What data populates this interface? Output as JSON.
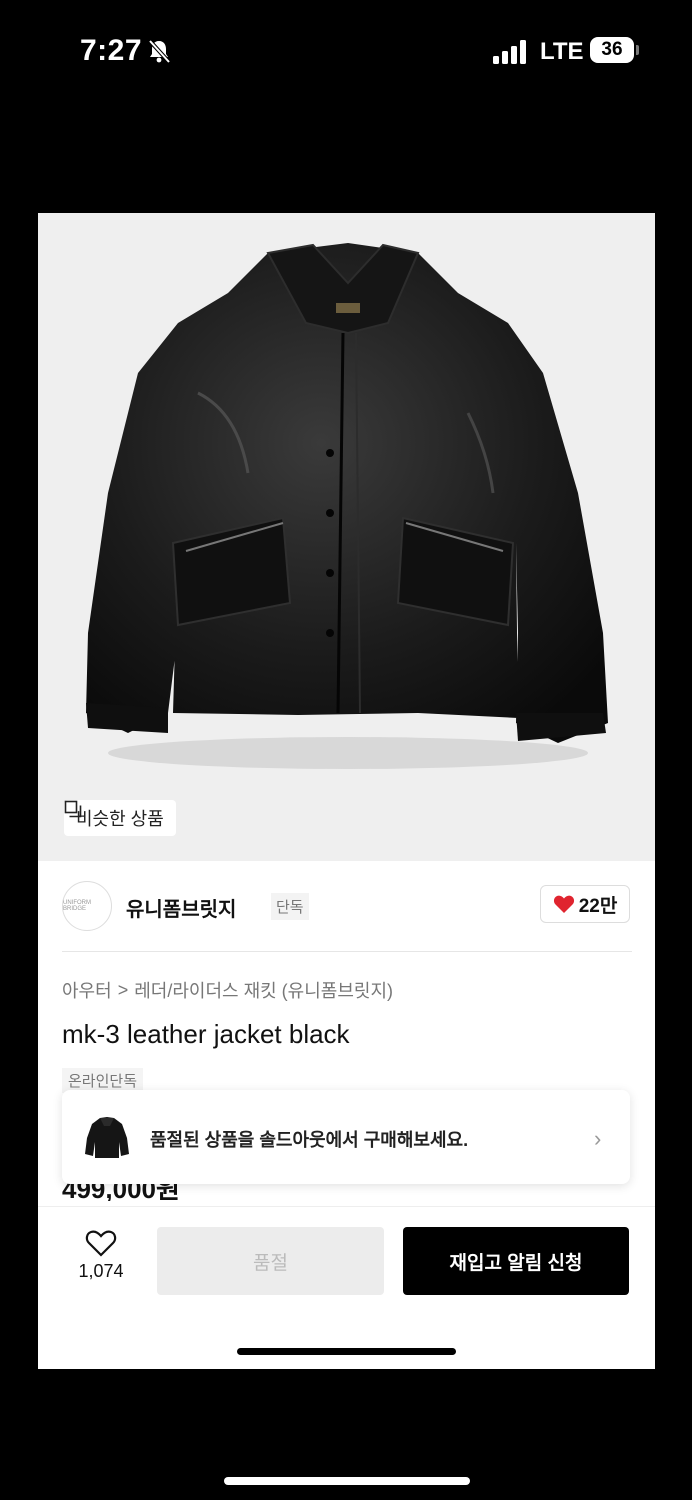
{
  "status_bar": {
    "time": "7:27",
    "network": "LTE",
    "battery": "36"
  },
  "product_image": {
    "overlay_button": "비슷한 상품"
  },
  "brand": {
    "logo_text": "UNIFORM BRIDGE",
    "name": "유니폼브릿지",
    "tag": "단독",
    "likes": "22만"
  },
  "breadcrumb": {
    "category": "아우터",
    "separator": ">",
    "subcategory": "레더/라이더스 재킷 (유니폼브릿지)"
  },
  "product": {
    "title": "mk-3 leather jacket black",
    "badge": "온라인단독",
    "price": "499,000원"
  },
  "banner": {
    "text": "품절된 상품을 솔드아웃에서 구매해보세요.",
    "chevron": "›"
  },
  "bottom_bar": {
    "wish_count": "1,074",
    "soldout_label": "품절",
    "restock_label": "재입고 알림 신청"
  },
  "colors": {
    "accent_red": "#e0242f",
    "primary_black": "#000000"
  }
}
